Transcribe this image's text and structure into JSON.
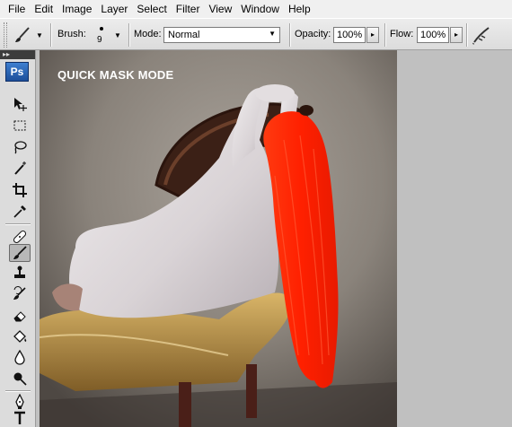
{
  "menu": [
    "File",
    "Edit",
    "Image",
    "Layer",
    "Select",
    "Filter",
    "View",
    "Window",
    "Help"
  ],
  "options": {
    "brush_label": "Brush:",
    "brush_size": "9",
    "mode_label": "Mode:",
    "mode_value": "Normal",
    "opacity_label": "Opacity:",
    "opacity_value": "100%",
    "flow_label": "Flow:",
    "flow_value": "100%"
  },
  "toolbox": {
    "logo": "Ps",
    "header": "▸▸",
    "tools": [
      "move-icon",
      "marquee-icon",
      "lasso-icon",
      "magic-wand-icon",
      "crop-icon",
      "eyedropper-icon",
      "healing-brush-icon",
      "brush-icon",
      "clone-stamp-icon",
      "history-brush-icon",
      "eraser-icon",
      "paint-bucket-icon",
      "blur-icon",
      "dodge-icon",
      "pen-icon",
      "type-icon"
    ],
    "active_tool": "brush-icon"
  },
  "document": {
    "overlay_text": "QUICK MASK MODE",
    "mask_color": "#ff2a00"
  }
}
